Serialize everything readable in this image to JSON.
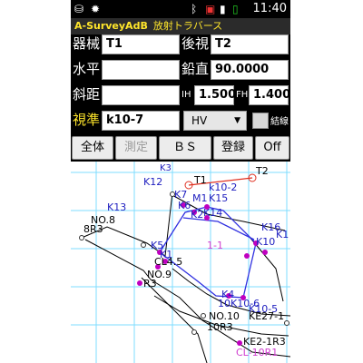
{
  "status": {
    "time": "11:40",
    "icons": [
      "usb-icon",
      "bug-icon",
      "bluetooth-icon",
      "alert-icon",
      "signal-icon",
      "battery-icon"
    ]
  },
  "app": {
    "title": "A-SurveyAdB",
    "subtitle": "放射トラバース"
  },
  "form": {
    "instrument_label": "器械",
    "instrument_value": "T1",
    "backsight_label": "後視",
    "backsight_value": "T2",
    "horizontal_label": "水平",
    "horizontal_value": "",
    "vertical_label": "鉛直",
    "vertical_value": "90.0000",
    "slope_label": "斜距",
    "slope_value": "",
    "ih_label": "IH",
    "ih_value": "1.500",
    "fh_label": "FH",
    "fh_value": "1.400",
    "sight_label": "視準",
    "sight_value": "k10-7",
    "mode_value": "HV",
    "link_label": "結線"
  },
  "buttons": {
    "all": "全体",
    "measure": "測定",
    "bs": "ＢＳ",
    "register": "登録",
    "off": "Off"
  },
  "map_labels": {
    "k3": "K3",
    "k12": "K12",
    "t1": "T1",
    "t2": "T2",
    "k10_2": "k10-2",
    "k7": "K7",
    "m1": "M1",
    "k15": "K15",
    "k6": "K6",
    "k2": "K2",
    "k14": "K14",
    "k13": "K13",
    "no8": "NO.8",
    "r3_1": "8R3",
    "k16": "K16",
    "k10": "K10",
    "k1_right": "K1",
    "k5": "K5",
    "k1": "K1",
    "area": "1-1",
    "cl": "CL4.5",
    "no9": "NO.9",
    "r3_2": "R3",
    "k4": "K4",
    "k10_label": "10K10-6",
    "k10_5": "K10-5",
    "no10": "NO.10",
    "ke27": "KE27-1",
    "r10": "10R3",
    "ke2_1": "KE2-1R3",
    "cl_bottom": "CL-10R1"
  },
  "colors": {
    "grid": "#7fdcff",
    "blue_line": "#3030e0",
    "magenta_point": "#c000c0",
    "red_line": "#e03020",
    "label_magenta": "#d040d0",
    "label_blue": "#2020c0",
    "status_yellow": "#ffe62b"
  }
}
